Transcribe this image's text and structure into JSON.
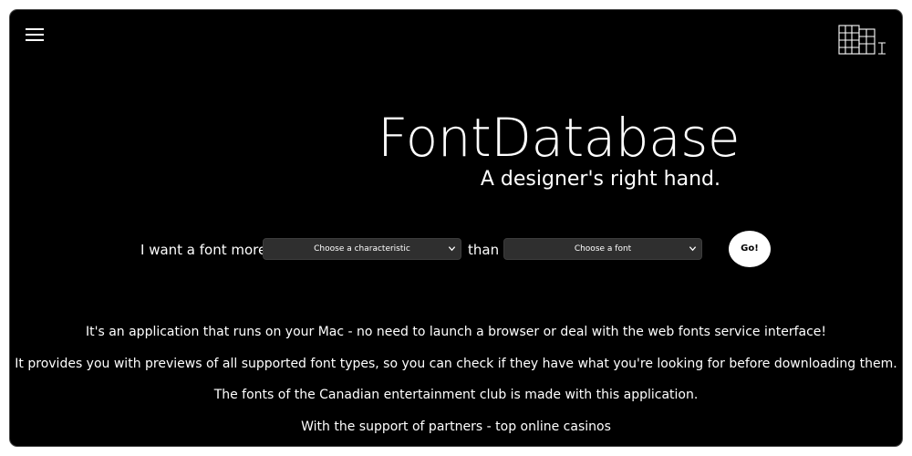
{
  "header": {
    "menu_icon": "hamburger-menu-icon",
    "logo_icon": "fontdatabase-logo-icon"
  },
  "hero": {
    "title": "FontDatabase",
    "tagline": "A designer's right hand."
  },
  "search": {
    "prefix_label": "I want a font more",
    "characteristic_select": {
      "selected": "Choose a characteristic"
    },
    "connector_label": "than",
    "font_select": {
      "selected": "Choose a font"
    },
    "go_label": "Go!"
  },
  "info": {
    "lines": [
      "It's an application that runs on your Mac - no need to launch a browser or deal with the web fonts service interface!",
      "It provides you with previews of all supported font types, so you can check if they have what you're looking for before downloading them.",
      "The fonts of the Canadian entertainment club is made with this application.",
      "With the support of partners - top online casinos"
    ]
  },
  "colors": {
    "background": "#000000",
    "text": "#ffffff",
    "select_bg": "#2f2f2f",
    "button_bg": "#ffffff"
  }
}
